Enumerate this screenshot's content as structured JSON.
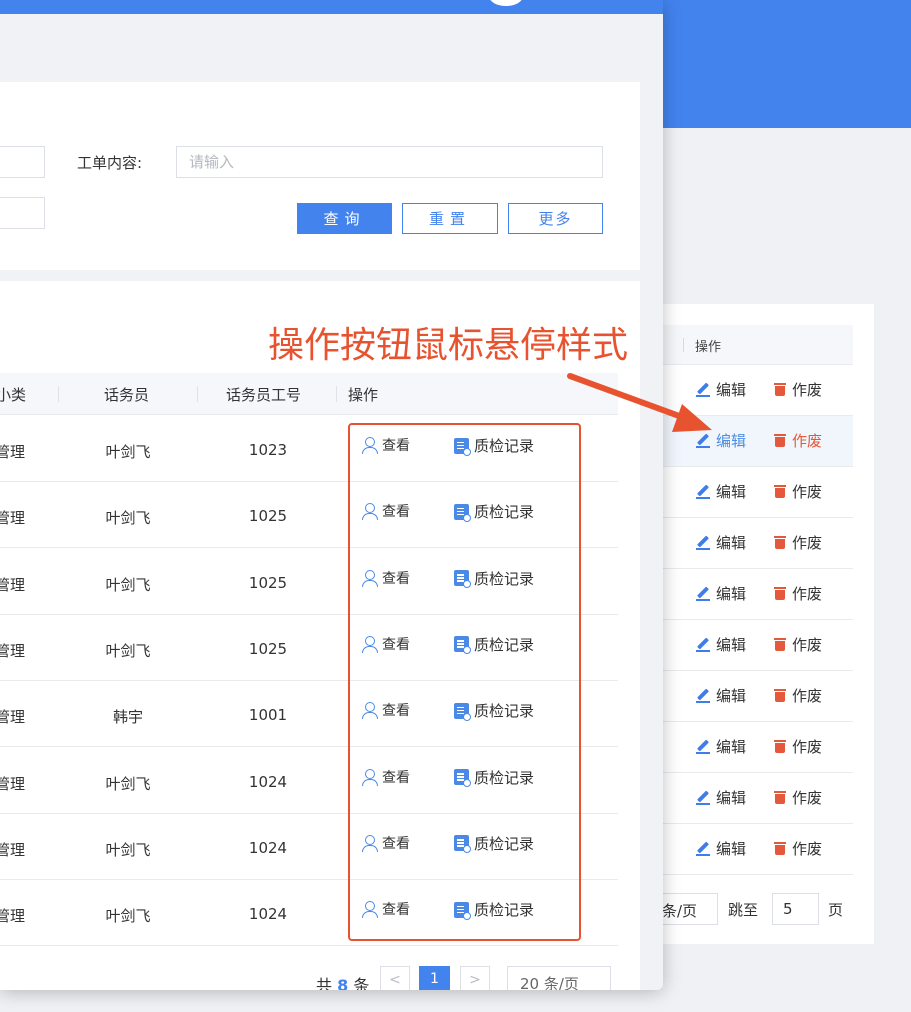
{
  "background_window": {
    "column_header": "操作",
    "rows": [
      {
        "edit": "编辑",
        "void": "作废"
      },
      {
        "edit": "编辑",
        "void": "作废"
      },
      {
        "edit": "编辑",
        "void": "作废"
      },
      {
        "edit": "编辑",
        "void": "作废"
      },
      {
        "edit": "编辑",
        "void": "作废"
      },
      {
        "edit": "编辑",
        "void": "作废"
      },
      {
        "edit": "编辑",
        "void": "作废"
      },
      {
        "edit": "编辑",
        "void": "作废"
      },
      {
        "edit": "编辑",
        "void": "作废"
      },
      {
        "edit": "编辑",
        "void": "作废"
      }
    ],
    "hover_row_index": 1,
    "pager": {
      "per_page_suffix": "条/页",
      "jump_label": "跳至",
      "jump_value": "5",
      "page_suffix": "页"
    }
  },
  "filter": {
    "content_label": "工单内容:",
    "content_placeholder": "请输入",
    "query_label": "查询",
    "reset_label": "重置",
    "more_label": "更多"
  },
  "table": {
    "headers": [
      "小类",
      "话务员",
      "话务员工号",
      "操作"
    ],
    "rows": [
      {
        "category": "管理",
        "operator": "叶剑飞",
        "operator_id": "1023",
        "view": "查看",
        "record": "质检记录"
      },
      {
        "category": "管理",
        "operator": "叶剑飞",
        "operator_id": "1025",
        "view": "查看",
        "record": "质检记录"
      },
      {
        "category": "管理",
        "operator": "叶剑飞",
        "operator_id": "1025",
        "view": "查看",
        "record": "质检记录"
      },
      {
        "category": "管理",
        "operator": "叶剑飞",
        "operator_id": "1025",
        "view": "查看",
        "record": "质检记录"
      },
      {
        "category": "管理",
        "operator": "韩宇",
        "operator_id": "1001",
        "view": "查看",
        "record": "质检记录"
      },
      {
        "category": "管理",
        "operator": "叶剑飞",
        "operator_id": "1024",
        "view": "查看",
        "record": "质检记录"
      },
      {
        "category": "管理",
        "operator": "叶剑飞",
        "operator_id": "1024",
        "view": "查看",
        "record": "质检记录"
      },
      {
        "category": "管理",
        "operator": "叶剑飞",
        "operator_id": "1024",
        "view": "查看",
        "record": "质检记录"
      }
    ]
  },
  "pagination": {
    "total_prefix": "共",
    "total_count": "8",
    "total_suffix": "条",
    "prev": "<",
    "current_page": "1",
    "next": ">",
    "page_size": "20 条/页"
  },
  "annotation": {
    "text": "操作按钮鼠标悬停样式",
    "color": "#e8532f"
  },
  "colors": {
    "brand": "#4383ee",
    "link_hover": "#4c8de4",
    "danger": "#e4583c"
  }
}
